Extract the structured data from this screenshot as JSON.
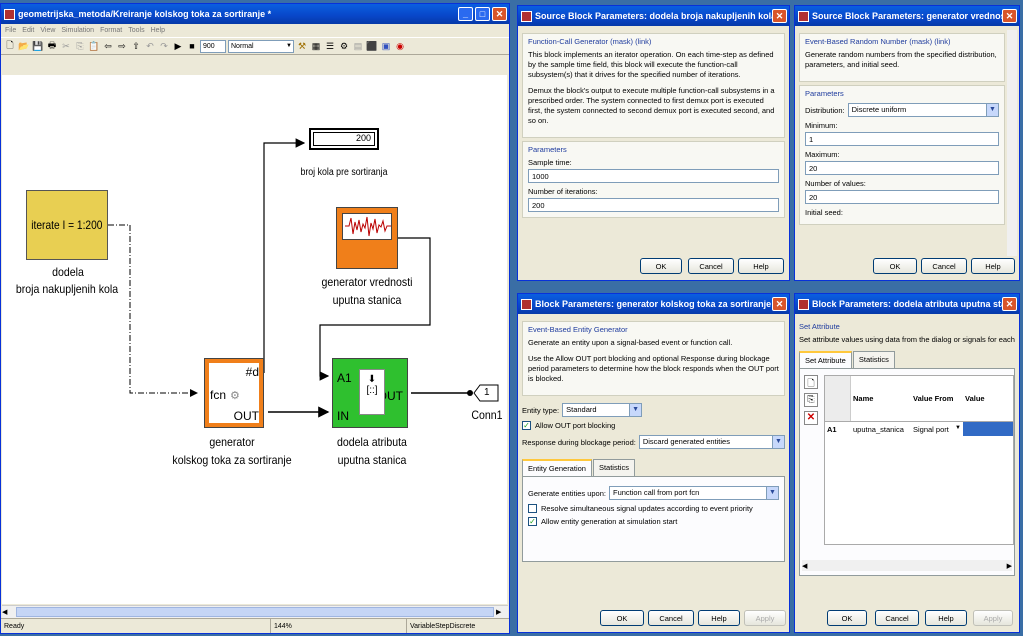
{
  "model_window": {
    "title": "geometrijska_metoda/Kreiranje kolskog toka za sortiranje *",
    "menu": [
      "File",
      "Edit",
      "View",
      "Simulation",
      "Format",
      "Tools",
      "Help"
    ],
    "stop_time": "900",
    "sim_mode": "Normal",
    "status": {
      "state": "Ready",
      "zoom": "144%",
      "solver": "VariableStepDiscrete"
    },
    "blocks": {
      "iterator": {
        "text": "iterate I = 1:200",
        "label_line1": "dodela",
        "label_line2": "broja nakupljenih kola"
      },
      "display": {
        "value": "200",
        "label": "broj kola pre sortiranja"
      },
      "random": {
        "label_line1": "generator vrednosti",
        "label_line2": "uputna stanica"
      },
      "entity_gen": {
        "port_fcn": "fcn",
        "port_hash": "#d",
        "port_out": "OUT",
        "label_line1": "generator",
        "label_line2": "kolskog toka za sortiranje"
      },
      "set_attr": {
        "port_a1": "A1",
        "port_in": "IN",
        "port_out": "OUT",
        "label_line1": "dodela atributa",
        "label_line2": "uputna stanica"
      },
      "conn": {
        "num": "1",
        "label": "Conn1"
      }
    }
  },
  "dlg1": {
    "title": "Source Block Parameters: dodela broja nakupljenih kola",
    "group": "Function-Call Generator (mask) (link)",
    "desc1": "This block implements an iterator operation. On each time-step as defined by the sample time field, this block will execute the function-call subsystem(s) that it drives for the specified number of iterations.",
    "desc2": "Demux the block's output to execute multiple function-call subsystems in a prescribed order.  The system connected to first demux port is executed first, the system connected to second demux port is executed second, and so on.",
    "params": "Parameters",
    "sample_label": "Sample time:",
    "sample_value": "1000",
    "iter_label": "Number of iterations:",
    "iter_value": "200",
    "ok": "OK",
    "cancel": "Cancel",
    "help": "Help"
  },
  "dlg2": {
    "title": "Source Block Parameters: generator vrednosti uputna stanica",
    "group": "Event-Based Random Number (mask) (link)",
    "desc": "Generate random numbers from the specified distribution, parameters, and initial seed.",
    "params": "Parameters",
    "dist_label": "Distribution:",
    "dist_value": "Discrete uniform",
    "min_label": "Minimum:",
    "min_value": "1",
    "max_label": "Maximum:",
    "max_value": "20",
    "nvals_label": "Number of values:",
    "nvals_value": "20",
    "seed_label": "Initial seed:",
    "ok": "OK",
    "cancel": "Cancel",
    "help": "Help"
  },
  "dlg3": {
    "title": "Block Parameters: generator kolskog toka za sortiranje",
    "group": "Event-Based Entity Generator",
    "desc1": "Generate an entity upon a signal-based event or function call.",
    "desc2": "Use the Allow OUT port blocking and optional Response during blockage period parameters to determine how the block responds when the OUT port is blocked.",
    "etype_label": "Entity type:",
    "etype_value": "Standard",
    "allow_label": "Allow OUT port blocking",
    "resp_label": "Response during blockage period:",
    "resp_value": "Discard generated entities",
    "tab1": "Entity Generation",
    "tab2": "Statistics",
    "gen_label": "Generate entities upon:",
    "gen_value": "Function call from port fcn",
    "resolve_label": "Resolve simultaneous signal updates according to event priority",
    "allow_start_label": "Allow entity generation at simulation start",
    "ok": "OK",
    "cancel": "Cancel",
    "help": "Help",
    "apply": "Apply"
  },
  "dlg4": {
    "title": "Block Parameters: dodela atributa uputna stanica",
    "group": "Set Attribute",
    "desc": "Set attribute values using data from the dialog or signals for each dep",
    "tab1": "Set Attribute",
    "tab2": "Statistics",
    "col_name": "Name",
    "col_from": "Value From",
    "col_value": "Value",
    "row": {
      "id": "A1",
      "name": "uputna_stanica",
      "from": "Signal port"
    },
    "ok": "OK",
    "cancel": "Cancel",
    "help": "Help",
    "apply": "Apply"
  }
}
